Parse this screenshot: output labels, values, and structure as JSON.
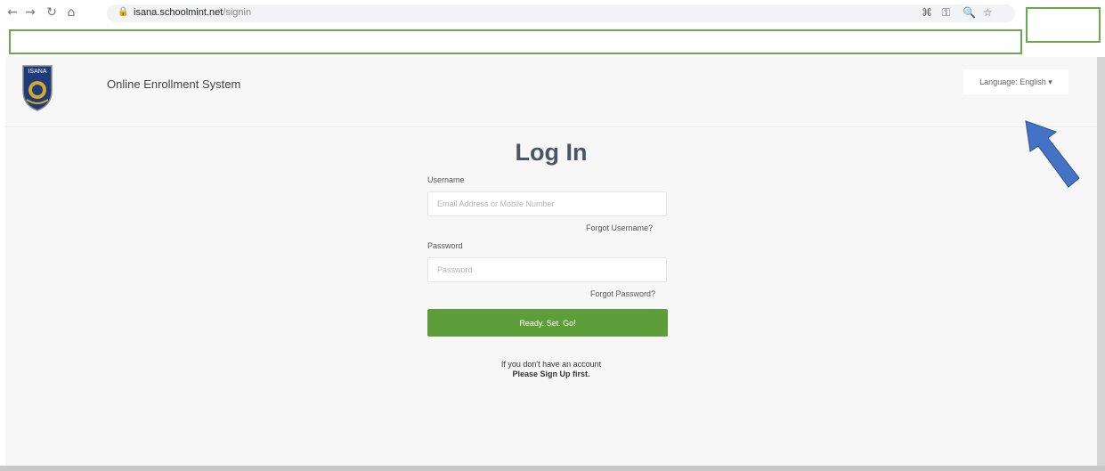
{
  "browser": {
    "url_host": "isana.schoolmint.net",
    "url_path": "/signin"
  },
  "icons": {
    "back": "←",
    "forward": "→",
    "reload": "↻",
    "home": "⌂",
    "lock": "🔒",
    "apps": "⌘",
    "key": "⚿",
    "zoom": "🔍",
    "star": "☆"
  },
  "header": {
    "logo_text": "ISANA",
    "title": "Online Enrollment System",
    "language_label": "Language:",
    "language_value": "English",
    "language_caret": "▾"
  },
  "login": {
    "title": "Log In",
    "username_label": "Username",
    "username_placeholder": "Email Address or Mobile Number",
    "forgot_username": "Forgot Username?",
    "password_label": "Password",
    "password_placeholder": "Password",
    "forgot_password": "Forgot Password?",
    "submit_label": "Ready. Set. Go!",
    "signup_line1": "If you don't have an account",
    "signup_line2": "Please Sign Up first."
  },
  "colors": {
    "annotation_box": "#6aa84f",
    "annotation_arrow": "#4472c4",
    "submit_button": "#5e9e3a"
  }
}
